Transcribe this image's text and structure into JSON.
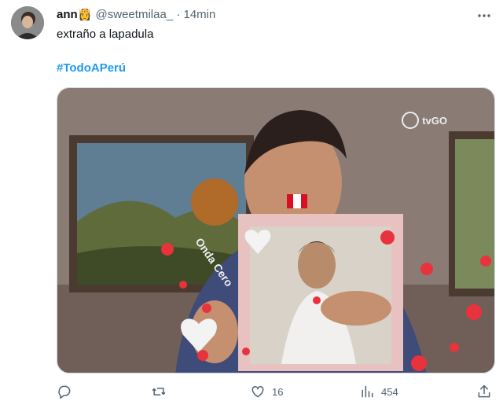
{
  "tweet": {
    "name": "ann",
    "handle": "@sweetmilaa_",
    "separator": "·",
    "time": "14min",
    "text": "extraño a lapadula",
    "hashtag": "#TodoAPerú"
  },
  "media": {
    "watermark": "tvGO",
    "overlay_text": "Onda Cero"
  },
  "actions": {
    "reply_count": "",
    "retweet_count": "",
    "like_count": "16",
    "views_count": "454"
  },
  "icons": [
    "reply-icon",
    "retweet-icon",
    "heart-icon",
    "views-icon",
    "share-icon",
    "more-icon"
  ],
  "colors": {
    "accent": "#1d9bf0",
    "muted": "#536471",
    "text": "#0f1419"
  }
}
